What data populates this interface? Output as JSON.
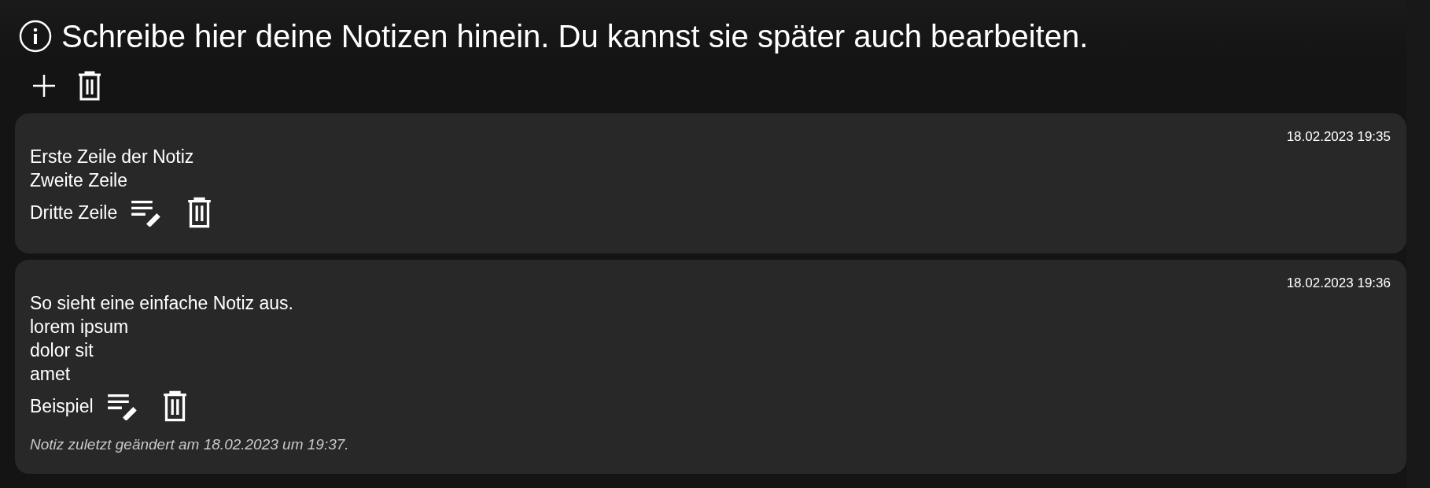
{
  "header": {
    "text": "Schreibe hier deine Notizen hinein. Du kannst sie später auch bearbeiten."
  },
  "notes": [
    {
      "timestamp": "18.02.2023 19:35",
      "lines": [
        "Erste Zeile der Notiz",
        "Zweite Zeile",
        "Dritte Zeile"
      ]
    },
    {
      "timestamp": "18.02.2023 19:36",
      "lines": [
        "So sieht eine einfache Notiz aus.",
        "lorem ipsum",
        "dolor sit",
        "amet",
        "Beispiel"
      ],
      "footer": "Notiz zuletzt geändert am 18.02.2023 um 19:37."
    }
  ]
}
